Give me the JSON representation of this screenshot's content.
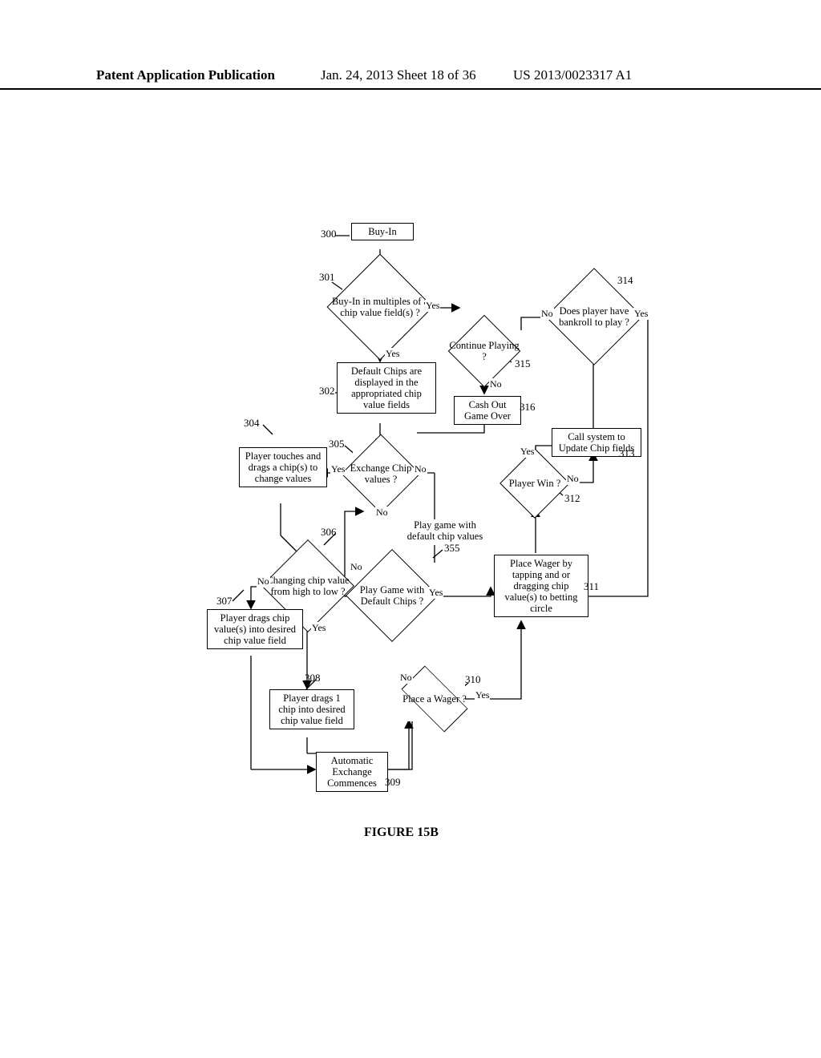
{
  "header": {
    "left": "Patent Application Publication",
    "mid": "Jan. 24, 2013  Sheet 18 of 36",
    "right": "US 2013/0023317 A1"
  },
  "caption": "FIGURE 15B",
  "refs": {
    "r300": "300",
    "r301": "301",
    "r302": "302",
    "r304": "304",
    "r305": "305",
    "r306": "306",
    "r307": "307",
    "r308": "308",
    "r309": "309",
    "r310": "310",
    "r311": "311",
    "r312": "312",
    "r313": "313",
    "r314": "314",
    "r315": "315",
    "r316": "316",
    "r355": "355"
  },
  "nodes": {
    "n300": "Buy-In",
    "n301": "Buy-In in multiples of a chip value field(s) ?",
    "n302": "Default Chips are displayed in the appropriated chip value fields",
    "n304": "Player touches and drags a chip(s) to change values",
    "n305": "Exchange Chip values ?",
    "n306": "Changing chip value from high to low ?",
    "n307": "Player drags chip value(s) into desired chip value field",
    "n308": "Player drags 1 chip into desired chip value field",
    "n309": "Automatic Exchange Commences",
    "n310": "Place a Wager ?",
    "n311": "Place Wager by tapping and or dragging chip value(s) to betting circle",
    "n312": "Player Win ?",
    "n313": "Call system to Update Chip fields",
    "n314": "Does player have bankroll to play ?",
    "n315": "Continue Playing ?",
    "n316": "Cash Out Game Over",
    "n355": "Play Game with Default Chips ?",
    "nPlayDefault": "Play game with default chip values"
  },
  "edges": {
    "yes": "Yes",
    "no": "No"
  }
}
